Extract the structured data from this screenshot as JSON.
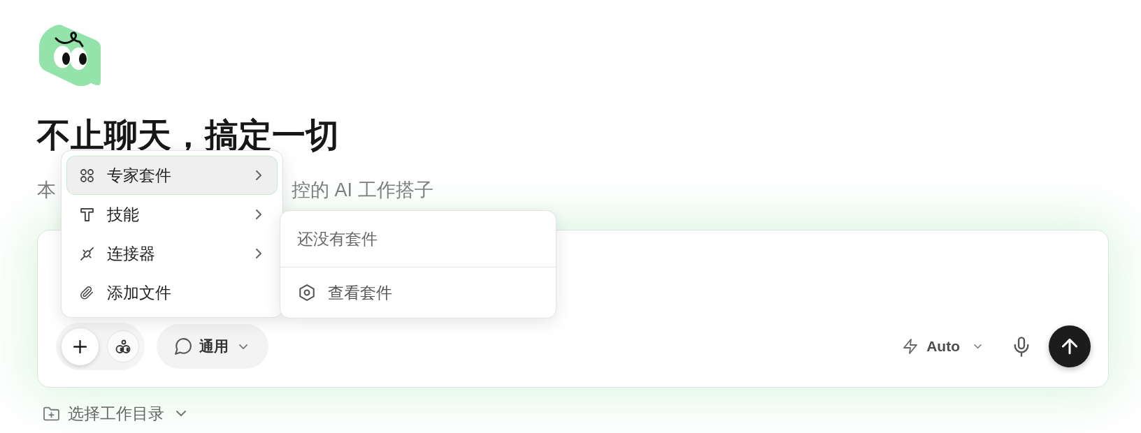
{
  "hero": {
    "title": "不止聊天，搞定一切",
    "subtitle_parts": [
      "本",
      "控的 AI 工作搭子"
    ]
  },
  "composer": {
    "mode": {
      "label": "通用"
    },
    "model": {
      "label": "Auto"
    }
  },
  "attach_menu": {
    "items": [
      {
        "kind": "suites",
        "label": "专家套件",
        "selected": true,
        "has_submenu": true
      },
      {
        "kind": "skills",
        "label": "技能",
        "selected": false,
        "has_submenu": true
      },
      {
        "kind": "connectors",
        "label": "连接器",
        "selected": false,
        "has_submenu": true
      },
      {
        "kind": "file",
        "label": "添加文件",
        "selected": false,
        "has_submenu": false
      }
    ],
    "open_submenu": {
      "empty_text": "还没有套件",
      "action": {
        "label": "查看套件"
      }
    }
  },
  "workdir": {
    "label": "选择工作目录"
  }
}
